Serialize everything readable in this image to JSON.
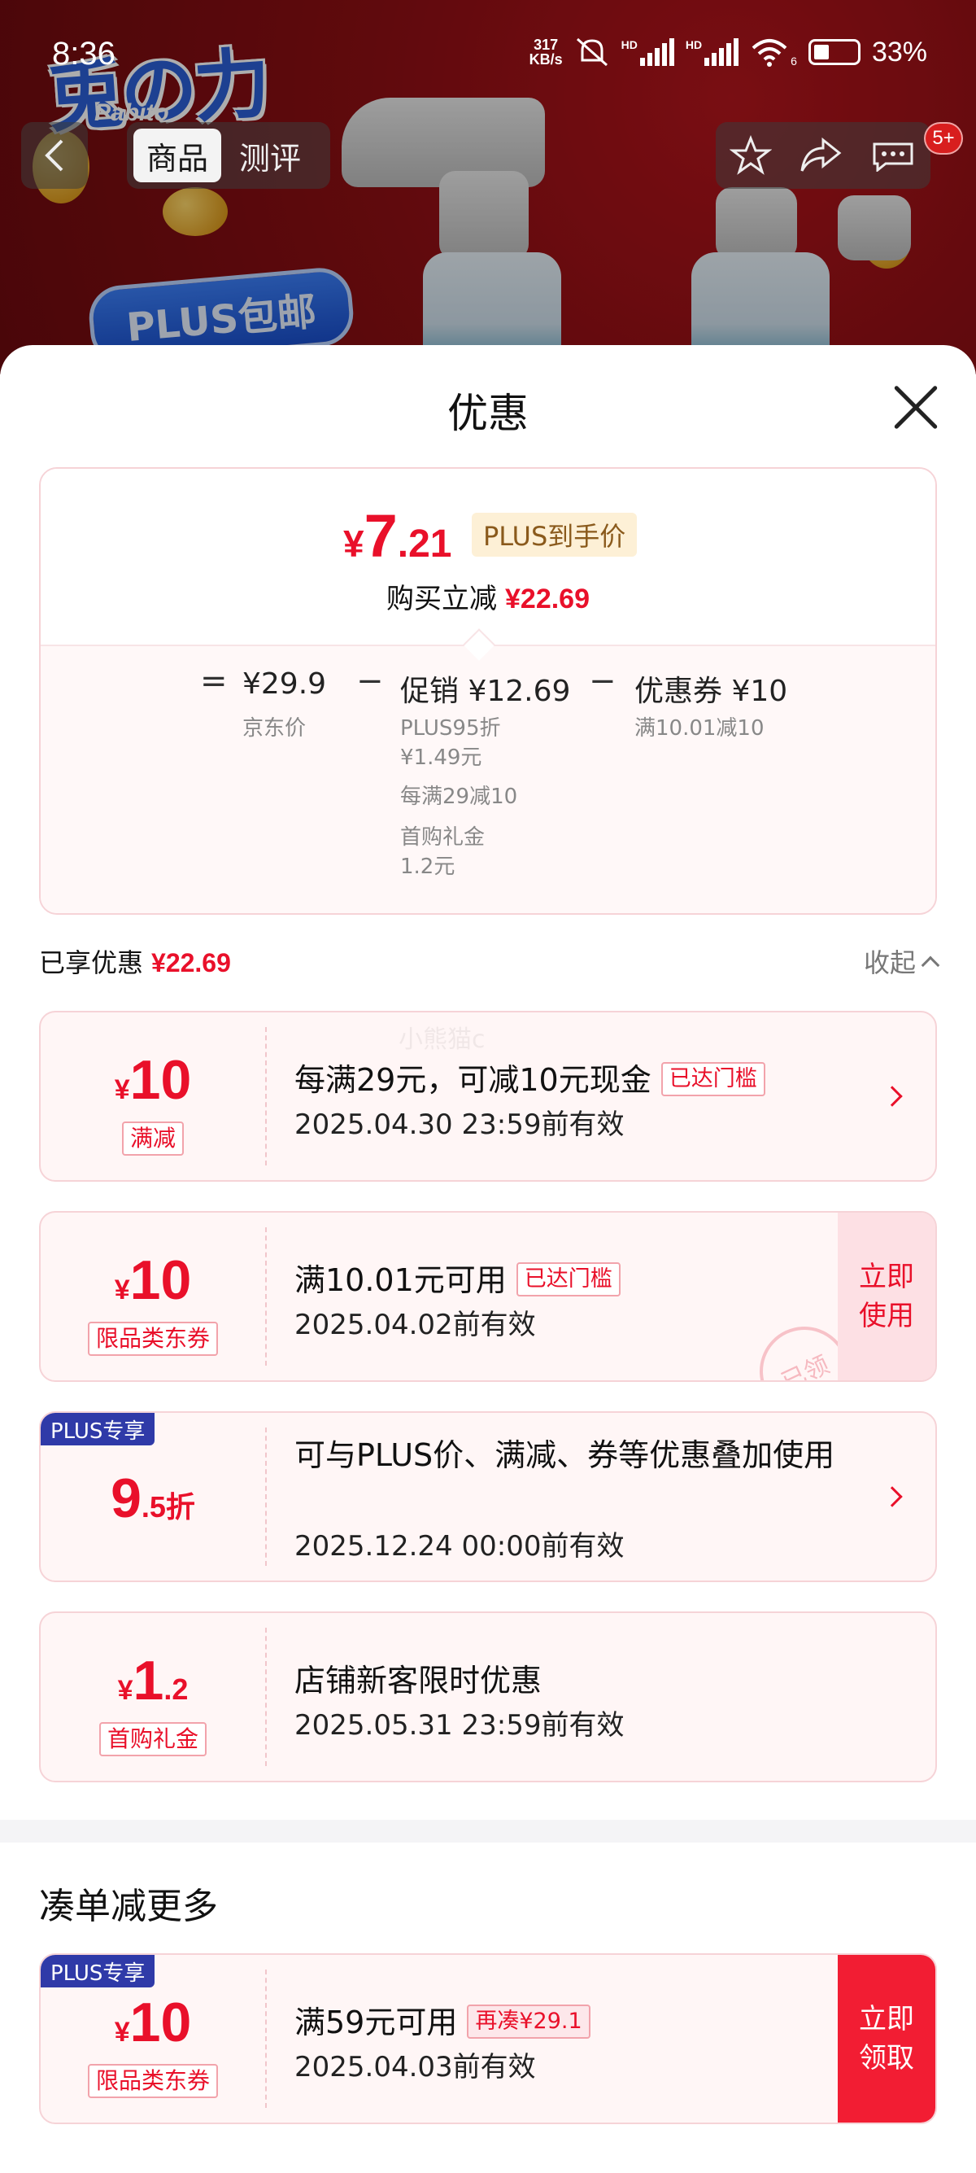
{
  "status_bar": {
    "time": "8:36",
    "net_speed_value": "317",
    "net_speed_unit": "KB/s",
    "hd1": "HD",
    "hd2": "HD",
    "wifi_slot": "6",
    "battery": "33%"
  },
  "banner": {
    "brand": "兎の力",
    "brand_sub": "Pabito",
    "promo": "PLUS包邮"
  },
  "nav": {
    "tabs": [
      "商品",
      "测评"
    ],
    "active_tab": 0,
    "message_badge": "5+"
  },
  "sheet": {
    "title": "优惠"
  },
  "price_summary": {
    "currency": "¥",
    "final_int": "7",
    "final_dec": ".21",
    "plus_label": "PLUS到手价",
    "reduce_label": "购买立减",
    "reduce_amount": "¥22.69",
    "equals": "=",
    "minus": "−",
    "jd_price": "¥29.9",
    "jd_price_label": "京东价",
    "promo_label": "促销 ¥12.69",
    "promo_items": [
      "PLUS95折",
      "¥1.49元",
      "每满29减10",
      "首购礼金",
      "1.2元"
    ],
    "coupon_label": "优惠券 ¥10",
    "coupon_cond": "满10.01减10"
  },
  "enjoyed": {
    "label": "已享优惠",
    "amount": "¥22.69",
    "collapse": "收起"
  },
  "watermark": "小熊猫c",
  "coupons": [
    {
      "yen": "¥",
      "big": "10",
      "small": "",
      "tag": "满减",
      "desc": "每满29元，可减10元现金",
      "cond": "已达门槛",
      "valid": "2025.04.30 23:59前有效"
    },
    {
      "yen": "¥",
      "big": "10",
      "small": "",
      "tag": "限品类东券",
      "desc": "满10.01元可用",
      "cond": "已达门槛",
      "valid": "2025.04.02前有效",
      "action": "立即使用",
      "stamp": "已领"
    },
    {
      "corner": "PLUS专享",
      "yen": "",
      "big": "9",
      "small": ".5折",
      "tag": "",
      "desc": "可与PLUS价、满减、券等优惠叠加使用",
      "valid": "2025.12.24 00:00前有效"
    },
    {
      "yen": "¥",
      "big": "1",
      "small": ".2",
      "tag": "首购礼金",
      "desc": "店铺新客限时优惠",
      "valid": "2025.05.31 23:59前有效"
    }
  ],
  "more_section": {
    "title": "凑单减更多",
    "coupon": {
      "corner": "PLUS专享",
      "yen": "¥",
      "big": "10",
      "tag": "限品类东券",
      "desc": "满59元可用",
      "cond": "再凑¥29.1",
      "valid": "2025.04.03前有效",
      "action": "立即领取"
    }
  },
  "colors": {
    "accent_red": "#e9102a",
    "plus_blue": "#2f3aa8",
    "plus_gold_bg": "#fdf0d6",
    "card_border": "#f6d3d7"
  }
}
